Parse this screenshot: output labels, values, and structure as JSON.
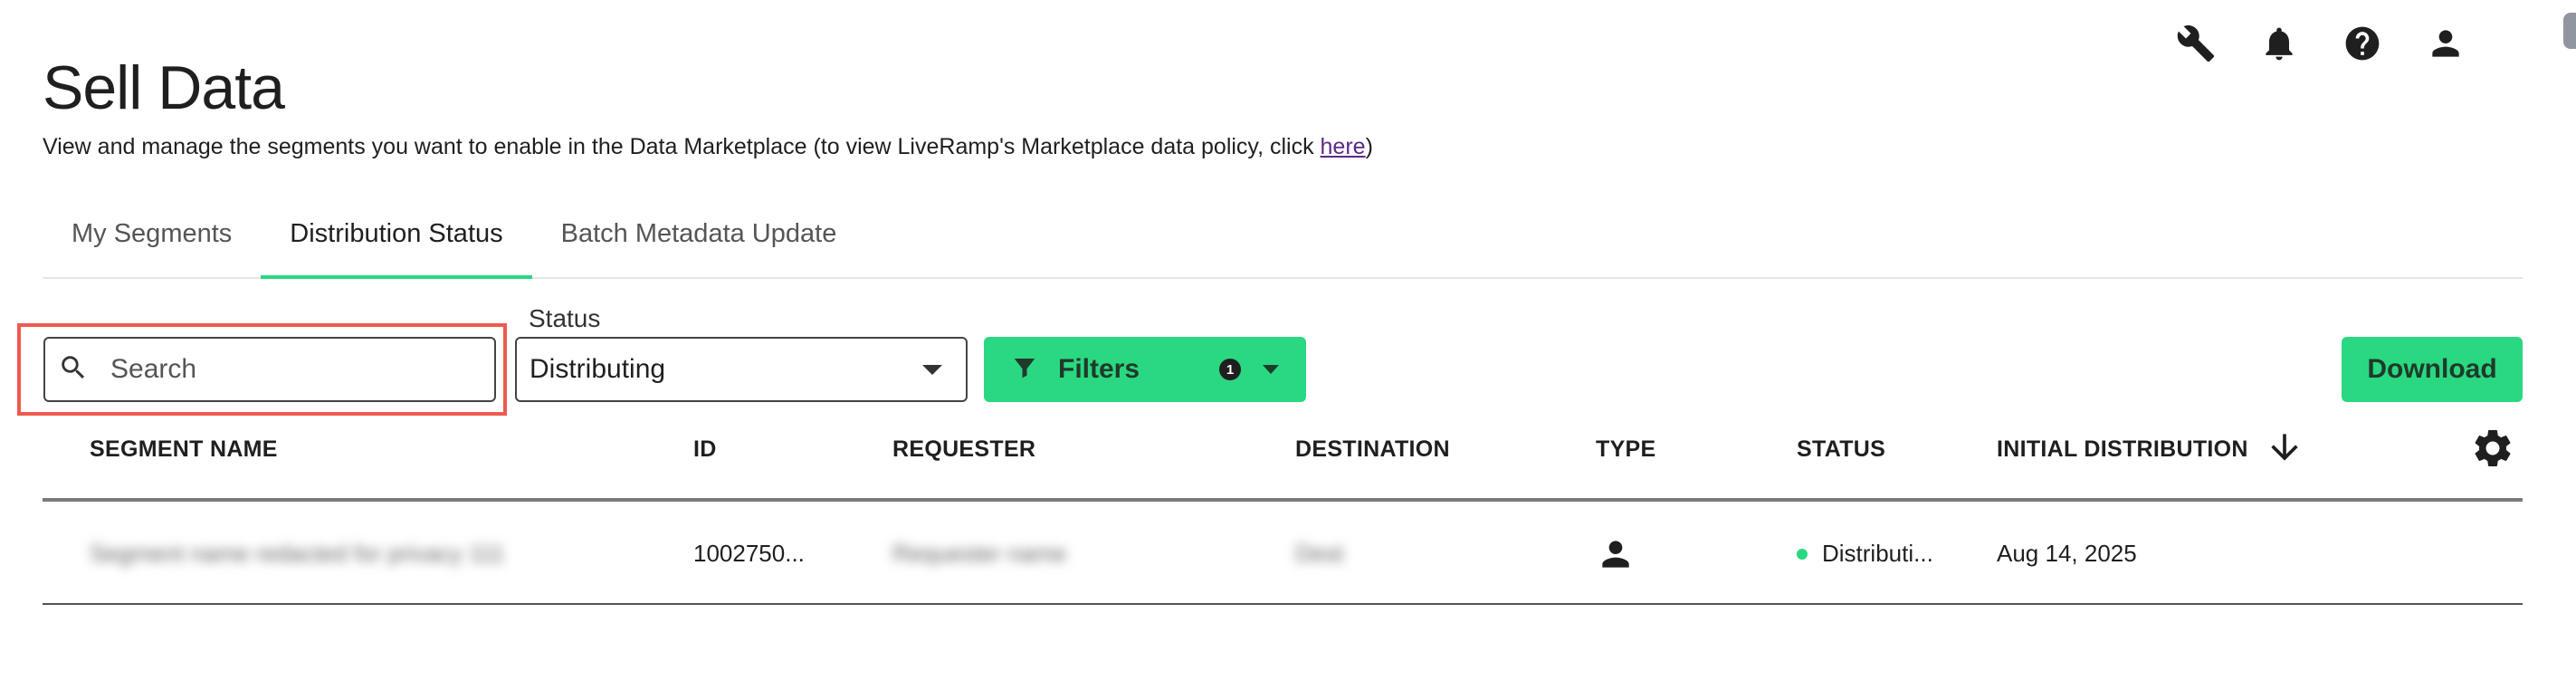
{
  "header": {
    "title": "Sell Data",
    "subtitle_prefix": "View and manage the segments you want to enable in the Data Marketplace (to view LiveRamp's Marketplace data policy, click ",
    "subtitle_link": "here",
    "subtitle_suffix": ")"
  },
  "top_icons": [
    "wrench-icon",
    "bell-icon",
    "help-icon",
    "user-icon"
  ],
  "tabs": [
    {
      "label": "My Segments",
      "active": false
    },
    {
      "label": "Distribution Status",
      "active": true
    },
    {
      "label": "Batch Metadata Update",
      "active": false
    }
  ],
  "toolbar": {
    "search_placeholder": "Search",
    "status_label": "Status",
    "status_value": "Distributing",
    "filters_label": "Filters",
    "filters_count": "1",
    "download_label": "Download"
  },
  "table": {
    "columns": [
      "SEGMENT NAME",
      "ID",
      "REQUESTER",
      "DESTINATION",
      "TYPE",
      "STATUS",
      "INITIAL DISTRIBUTION"
    ],
    "rows": [
      {
        "segment_name": "Segment name redacted for privacy 111",
        "id": "1002750...",
        "requester": "Requester name",
        "destination": "Dest",
        "type_icon": "person-icon",
        "status": "Distributi...",
        "initial_distribution": "Aug 14, 2025"
      }
    ]
  },
  "colors": {
    "accent_green": "#2ad882",
    "highlight_red": "#ee5a4f",
    "link_purple": "#5b2a86"
  }
}
